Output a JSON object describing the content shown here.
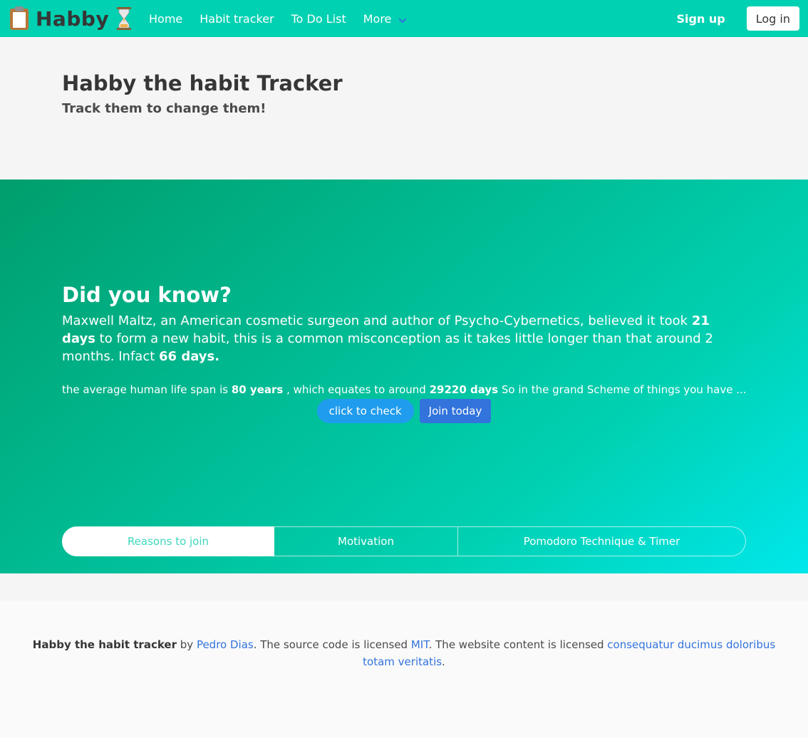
{
  "navbar": {
    "brand": "Habby",
    "brand_icon_left": "clipboard-icon",
    "brand_icon_right": "hourglass-icon",
    "links": [
      "Home",
      "Habit tracker",
      "To Do List",
      "More"
    ],
    "signup_label": "Sign up",
    "login_label": "Log in",
    "color": "#00d1b2"
  },
  "hero": {
    "title": "Habby the habit Tracker",
    "subtitle": "Track them to change them!"
  },
  "did_you_know": {
    "title": "Did you know?",
    "text_1": "Maxwell Maltz, an American cosmetic surgeon and author of Psycho-Cybernetics, believed it took ",
    "days_21": "21 days",
    "text_2": " to form a new habit, this is a common misconception as it takes little longer than that around 2 months. Infact ",
    "days_66": "66 days.",
    "life_1": "the average human life span is ",
    "years_80": "80 years",
    "life_2": " , which equates to around ",
    "days_29220": "29220 days",
    "life_3": " So in the grand Scheme of things you have ...",
    "check_label": "click to check",
    "join_label": "Join today"
  },
  "tabs": [
    "Reasons to join",
    "Motivation",
    "Pomodoro Technique & Timer"
  ],
  "footer": {
    "name": "Habby the habit tracker",
    "by": " by ",
    "author": "Pedro Dias",
    "mid_1": ". The source code is licensed ",
    "license": "MIT",
    "mid_2": ". The website content is licensed ",
    "content_license": "consequatur ducimus doloribus totam veritatis",
    "end": "."
  }
}
